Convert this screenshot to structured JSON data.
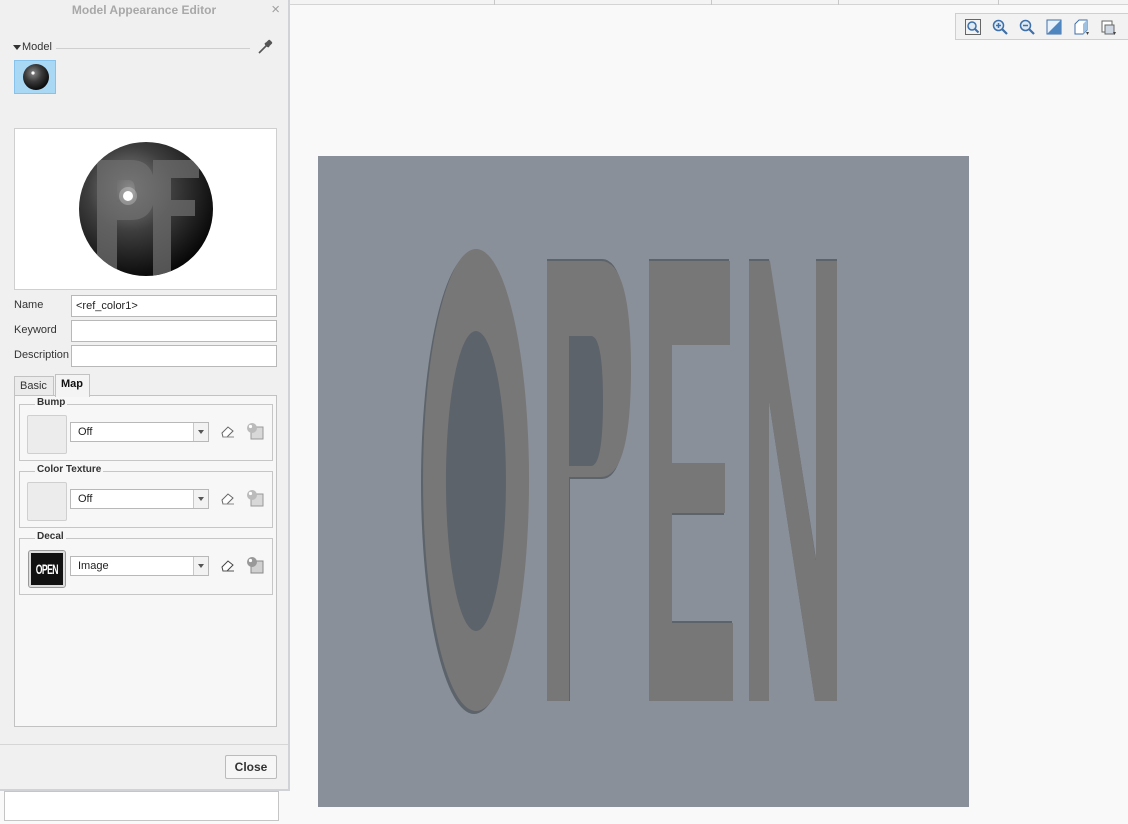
{
  "window": {
    "title": "Model Appearance Editor",
    "close_glyph": "×"
  },
  "model_section": {
    "label": "Model",
    "picker_icon": "eyedropper-icon"
  },
  "fields": {
    "name_label": "Name",
    "name_value": "<ref_color1>",
    "keyword_label": "Keyword",
    "keyword_value": "",
    "description_label": "Description",
    "description_value": ""
  },
  "tabs": [
    {
      "label": "Basic",
      "active": false
    },
    {
      "label": "Map",
      "active": true
    }
  ],
  "map_groups": {
    "bump": {
      "title": "Bump",
      "value": "Off"
    },
    "color_texture": {
      "title": "Color Texture",
      "value": "Off"
    },
    "decal": {
      "title": "Decal",
      "value": "Image",
      "thumbnail_text": "OPEN"
    }
  },
  "footer": {
    "close_label": "Close"
  },
  "view_toolbar": {
    "icons": [
      "refit-icon",
      "zoom-in-icon",
      "zoom-out-icon",
      "repaint-icon",
      "saved-orientations-icon",
      "display-style-icon"
    ]
  },
  "viewport": {
    "decal_text": "OPEN",
    "background_color": "#8a9099",
    "text_color": "#777777"
  }
}
